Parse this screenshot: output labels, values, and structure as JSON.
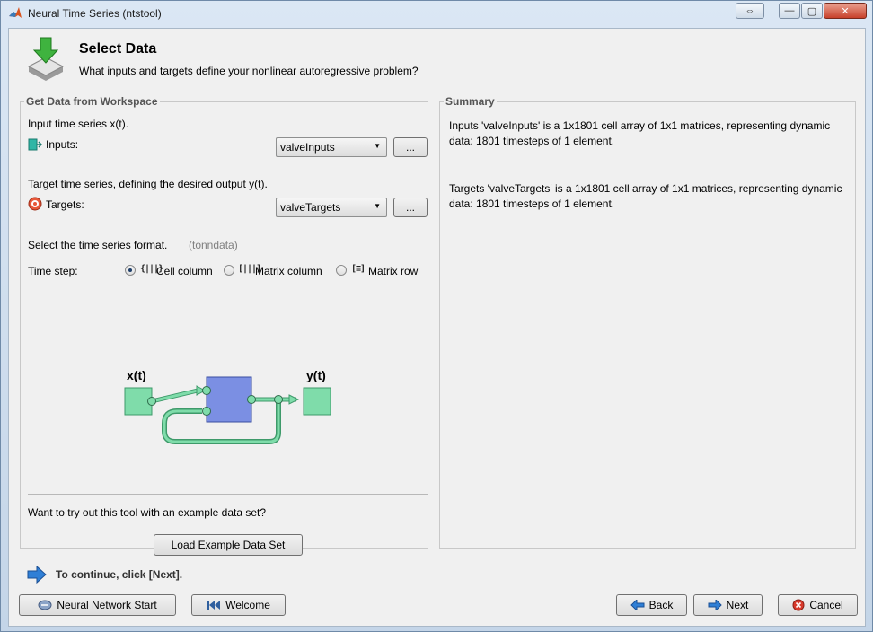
{
  "window": {
    "title": "Neural Time Series (ntstool)",
    "restore_label": "⇔",
    "minimize_label": "—",
    "maximize_label": "▢",
    "close_label": "✕"
  },
  "header": {
    "title": "Select Data",
    "subtitle": "What inputs and targets define your nonlinear autoregressive problem?"
  },
  "workspace": {
    "group_title": "Get Data from Workspace",
    "input_prompt": "Input time series x(t).",
    "inputs_label": "Inputs:",
    "inputs_value": "valveInputs",
    "inputs_browse": "...",
    "target_prompt": "Target time series, defining the desired output y(t).",
    "targets_label": "Targets:",
    "targets_value": "valveTargets",
    "targets_browse": "...",
    "format_prompt": "Select the time series format.",
    "format_hint": "(tonndata)",
    "timestep_label": "Time step:",
    "formats": [
      {
        "label": "Cell column",
        "icon": "{|||}",
        "selected": true
      },
      {
        "label": "Matrix column",
        "icon": "[|||]",
        "selected": false
      },
      {
        "label": "Matrix row",
        "icon": "[≡]",
        "selected": false
      }
    ],
    "diagram": {
      "x_label": "x(t)",
      "y_label": "y(t)"
    },
    "example_prompt": "Want to try out this tool with an example data set?",
    "example_button": "Load Example Data Set"
  },
  "summary": {
    "group_title": "Summary",
    "inputs_text": "Inputs 'valveInputs' is a 1x1801 cell array of 1x1 matrices, representing dynamic data: 1801 timesteps of 1 element.",
    "targets_text": "Targets 'valveTargets' is a 1x1801 cell array of 1x1 matrices, representing dynamic data: 1801 timesteps of 1 element."
  },
  "footer": {
    "hint": "To continue, click [Next].",
    "start_button": "Neural Network Start",
    "welcome_button": "Welcome",
    "back_button": "Back",
    "next_button": "Next",
    "cancel_button": "Cancel"
  },
  "colors": {
    "node_green": "#7fdcaa",
    "block_blue": "#7b8fe3",
    "arrow_blue": "#2f7fd6"
  }
}
